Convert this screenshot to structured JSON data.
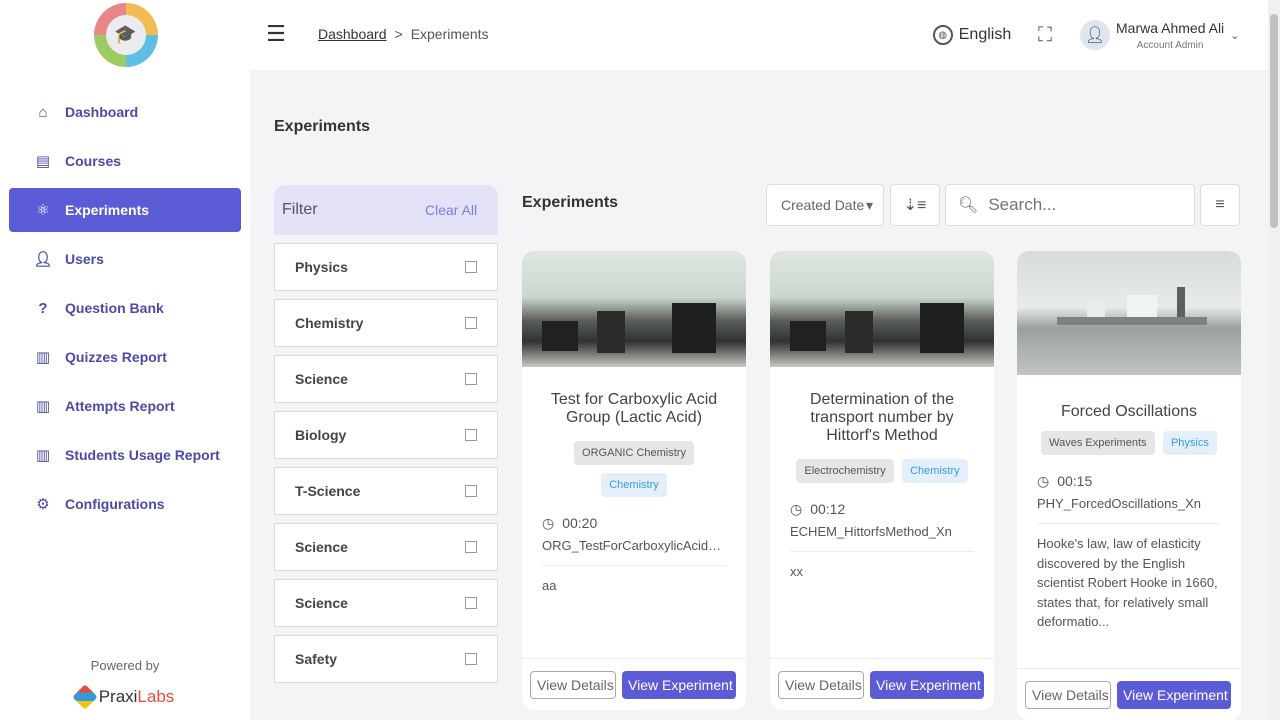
{
  "header": {
    "breadcrumb": {
      "link": "Dashboard",
      "separator": ">",
      "current": "Experiments"
    },
    "language": "English",
    "account": {
      "name": "Marwa Ahmed Ali",
      "role": "Account Admin"
    }
  },
  "sidebar": {
    "items": [
      {
        "label": "Dashboard",
        "icon": "home-icon"
      },
      {
        "label": "Courses",
        "icon": "book-icon"
      },
      {
        "label": "Experiments",
        "icon": "atom-icon",
        "active": true
      },
      {
        "label": "Users",
        "icon": "user-icon"
      },
      {
        "label": "Question Bank",
        "icon": "question-icon"
      },
      {
        "label": "Quizzes Report",
        "icon": "report-icon"
      },
      {
        "label": "Attempts Report",
        "icon": "report-icon"
      },
      {
        "label": "Students Usage Report",
        "icon": "report-icon"
      },
      {
        "label": "Configurations",
        "icon": "gear-icon"
      }
    ],
    "powered_by": "Powered by",
    "brand": {
      "left": "Praxi",
      "right": "Labs"
    }
  },
  "main": {
    "page_title": "Experiments",
    "section_title": "Experiments",
    "sort_label": "Created Date",
    "search_placeholder": "Search...",
    "filter": {
      "title": "Filter",
      "clear_label": "Clear All",
      "items": [
        "Physics",
        "Chemistry",
        "Science",
        "Biology",
        "T-Science",
        "Science",
        "Science",
        "Safety"
      ]
    },
    "cards": [
      {
        "title": "Test for Carboxylic Acid Group (Lactic Acid)",
        "tags": [
          "ORGANIC Chemistry",
          "Chemistry"
        ],
        "duration": "00:20",
        "code": "ORG_TestForCarboxylicAcidGroup",
        "description": "aa",
        "detail_label": "View Details",
        "experiment_label": "View Experiment"
      },
      {
        "title": "Determination of the transport number by Hittorf's Method",
        "tags": [
          "Electrochemistry",
          "Chemistry"
        ],
        "duration": "00:12",
        "code": "ECHEM_HittorfsMethod_Xn",
        "description": "xx",
        "detail_label": "View Details",
        "experiment_label": "View Experiment"
      },
      {
        "title": "Forced Oscillations",
        "tags": [
          "Waves Experiments",
          "Physics"
        ],
        "duration": "00:15",
        "code": "PHY_ForcedOscillations_Xn",
        "description": "Hooke's law, law of elasticity discovered by the English scientist Robert Hooke in 1660,  states that, for relatively small deformatio...",
        "detail_label": "View Details",
        "experiment_label": "View Experiment"
      }
    ]
  }
}
